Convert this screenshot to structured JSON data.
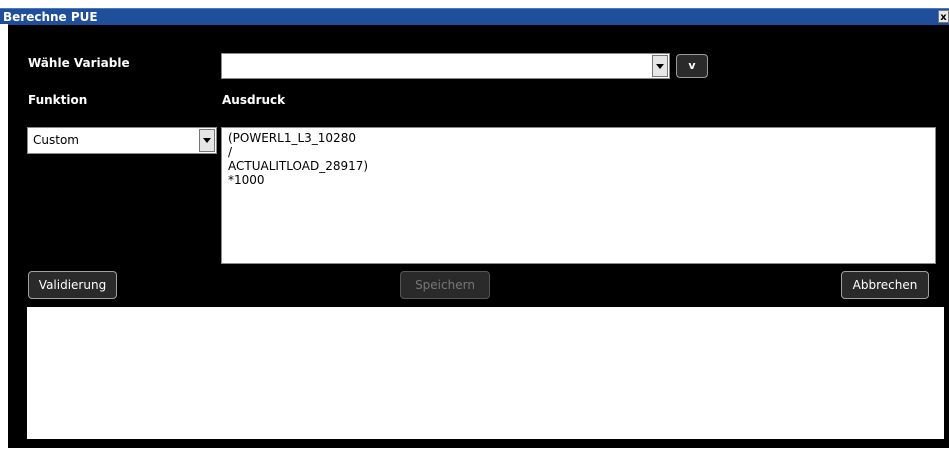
{
  "window": {
    "title": "Berechne PUE",
    "close_label": "x"
  },
  "form": {
    "variable_label": "Wähle Variable",
    "variable_value": "",
    "v_button_label": "v",
    "function_label": "Funktion",
    "expression_label": "Ausdruck",
    "function_value": "Custom",
    "expression_value": "(POWERL1_L3_10280\n/\nACTUALITLOAD_28917)\n*1000"
  },
  "buttons": {
    "validate": "Validierung",
    "save": "Speichern",
    "cancel": "Abbrechen"
  },
  "output": {
    "text": ""
  },
  "colors": {
    "titlebar": "#1f4e9a",
    "dialog_bg": "#000000",
    "button_bg": "#2a2a2a"
  }
}
